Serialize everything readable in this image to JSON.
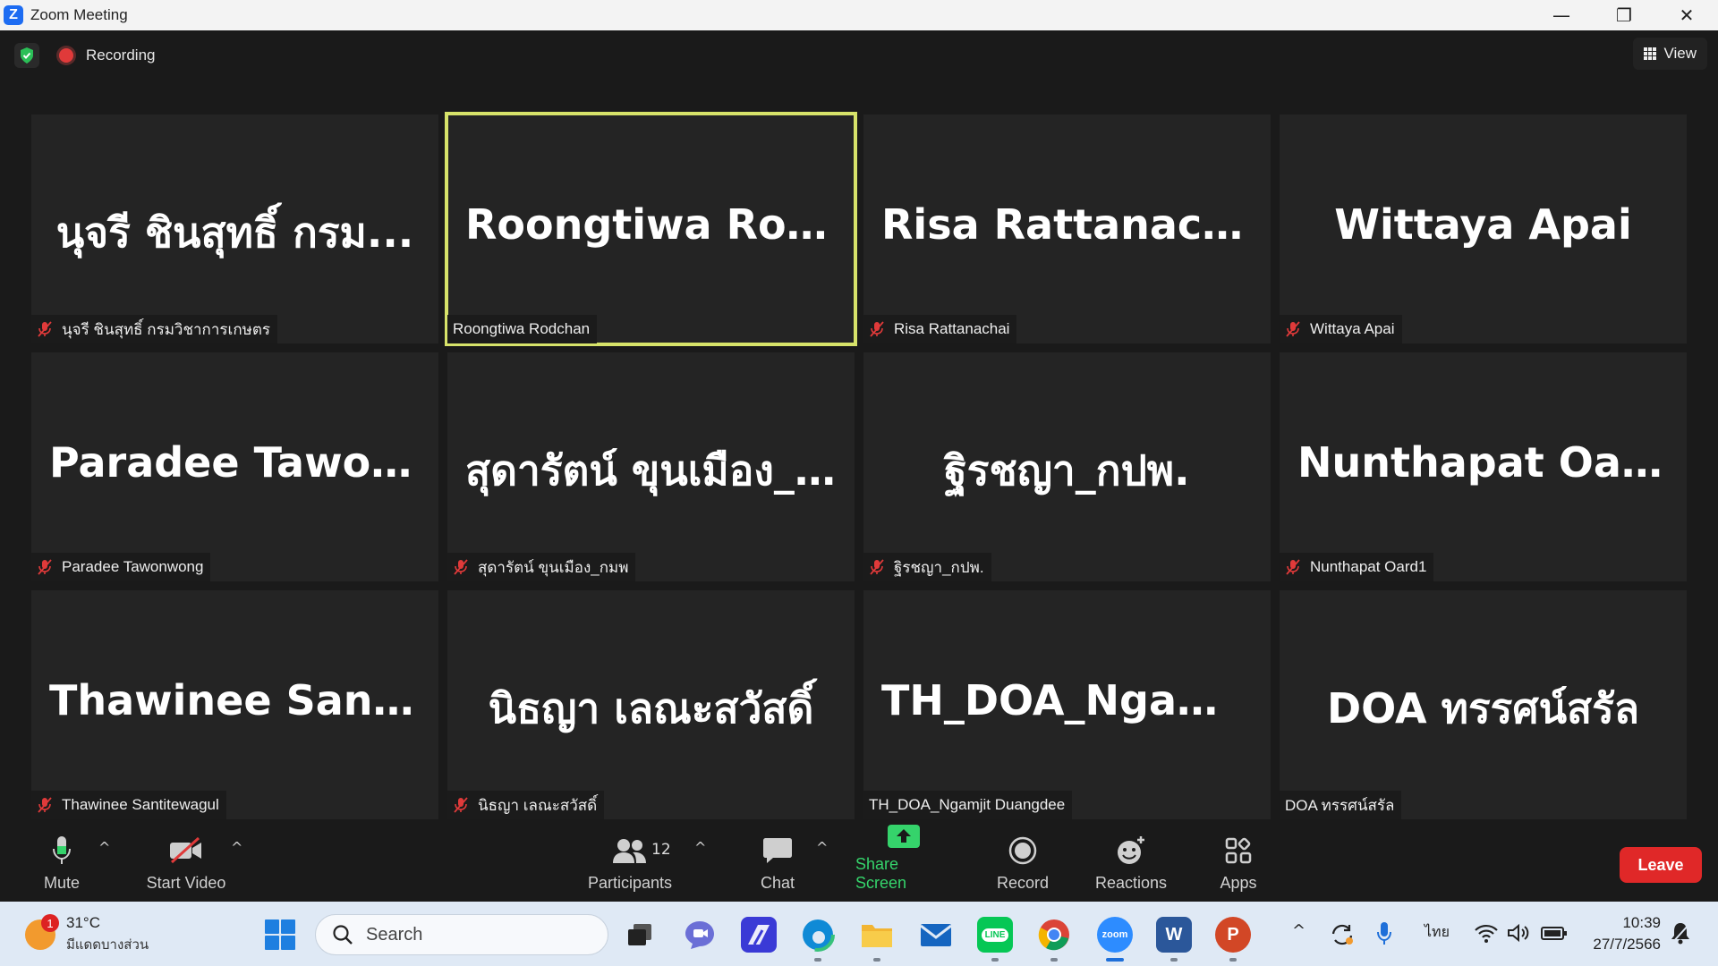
{
  "window": {
    "title": "Zoom Meeting",
    "logo_letter": "Z",
    "minimize": "—",
    "restore": "❐",
    "close": "✕"
  },
  "status": {
    "recording_label": "Recording",
    "view_label": "View"
  },
  "participants": [
    {
      "display": "นุจรี ชินสุทธิ์ กรม...",
      "label": "นุจรี ชินสุทธิ์ กรมวิชาการเกษตร",
      "muted": true,
      "active": false
    },
    {
      "display": "Roongtiwa Rodc...",
      "label": "Roongtiwa Rodchan",
      "muted": false,
      "active": true
    },
    {
      "display": "Risa Rattanachai",
      "label": "Risa Rattanachai",
      "muted": true,
      "active": false
    },
    {
      "display": "Wittaya Apai",
      "label": "Wittaya Apai",
      "muted": true,
      "active": false
    },
    {
      "display": "Paradee Tawonw...",
      "label": "Paradee Tawonwong",
      "muted": true,
      "active": false
    },
    {
      "display": "สุดารัตน์ ขุนเมือง_...",
      "label": "สุดารัตน์ ขุนเมือง_กมพ",
      "muted": true,
      "active": false
    },
    {
      "display": "ฐิรชญา_กปพ.",
      "label": "ฐิรชญา_กปพ.",
      "muted": true,
      "active": false
    },
    {
      "display": "Nunthapat Oard1",
      "label": "Nunthapat Oard1",
      "muted": true,
      "active": false
    },
    {
      "display": "Thawinee Santit...",
      "label": "Thawinee Santitewagul",
      "muted": true,
      "active": false
    },
    {
      "display": "นิธญา เลณะสวัสดิ์",
      "label": "นิธญา เลณะสวัสดิ์",
      "muted": true,
      "active": false
    },
    {
      "display": "TH_DOA_Ngamji...",
      "label": "TH_DOA_Ngamjit Duangdee",
      "muted": false,
      "active": false
    },
    {
      "display": "DOA ทรรศน์สรัล",
      "label": "DOA ทรรศน์สรัล",
      "muted": false,
      "active": false
    }
  ],
  "toolbar": {
    "mute": "Mute",
    "start_video": "Start Video",
    "participants": "Participants",
    "participants_count": "12",
    "chat": "Chat",
    "share_screen": "Share Screen",
    "record": "Record",
    "reactions": "Reactions",
    "apps": "Apps",
    "leave": "Leave",
    "caret": "^"
  },
  "taskbar": {
    "weather_temp": "31°C",
    "weather_desc": "มีแดดบางส่วน",
    "weather_badge": "1",
    "search_placeholder": "Search",
    "language": "ไทย",
    "tray_up": "^",
    "time": "10:39",
    "date": "27/7/2566",
    "apps": {
      "line": "LINE",
      "zoom": "zoom",
      "word": "W",
      "powerpoint": "P"
    }
  },
  "colors": {
    "active_speaker_border": "#d7e36a",
    "share_green": "#35d36b",
    "leave_red": "#e02828",
    "tile_bg": "#242424"
  }
}
